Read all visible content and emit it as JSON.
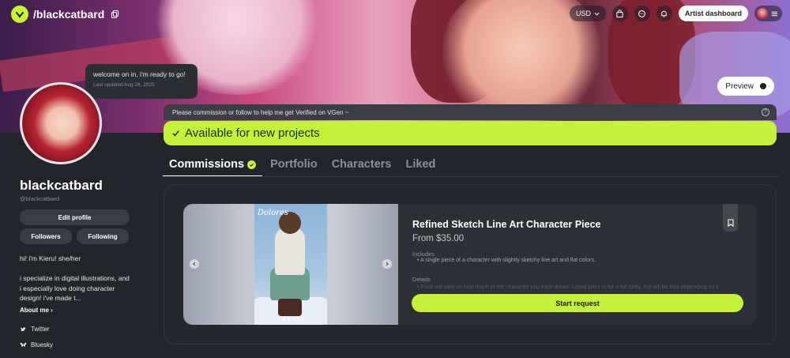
{
  "header": {
    "handle": "/blackcatbard",
    "currency": "USD",
    "artist_dashboard": "Artist dashboard"
  },
  "preview": {
    "label": "Preview"
  },
  "status": {
    "message": "welcome on in, i'm ready to go!",
    "updated": "Last updated Aug 26, 2025"
  },
  "profile": {
    "username": "blackcatbard",
    "subhandle": "@blackcatbard",
    "edit_profile": "Edit profile",
    "followers": "Followers",
    "following": "Following",
    "bio_line1": "hi! i'm Kieru! she/her",
    "bio_line2": "i specialize in digital illustrations, and i especially love doing character design! i've made t...",
    "about_me": "About me",
    "socials": [
      "Twitter",
      "Bluesky"
    ]
  },
  "banner_notice": {
    "verify_text": "Please commission or follow to help me get Verified on VGen ~",
    "help": "?",
    "available_text": "Available for new projects"
  },
  "tabs": [
    {
      "label": "Commissions",
      "active": true
    },
    {
      "label": "Portfolio",
      "active": false
    },
    {
      "label": "Characters",
      "active": false
    },
    {
      "label": "Liked",
      "active": false
    }
  ],
  "commission": {
    "title": "Refined Sketch Line Art Character Piece",
    "price": "From $35.00",
    "includes_label": "Includes",
    "includes_item": "A single piece of a character with slightly sketchy line art and flat colors.",
    "details_label": "Details",
    "details_item": "Price will vary on how much of the character you want drawn. Listed price is for a full body, but will be less depending on if",
    "start_request": "Start request",
    "art_signature": "Dolores",
    "image_count": 5,
    "active_image": 0
  },
  "colors": {
    "accent": "#c4f13a",
    "background": "#23252c",
    "card": "#2e3038"
  }
}
